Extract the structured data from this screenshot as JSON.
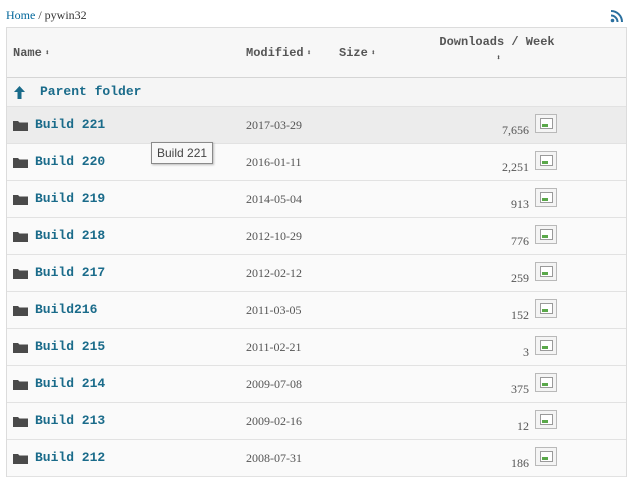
{
  "breadcrumb": {
    "home": "Home",
    "separator": "/",
    "current": "pywin32"
  },
  "columns": {
    "name": "Name",
    "modified": "Modified",
    "size": "Size",
    "downloads": "Downloads / Week",
    "sort_glyph": "⬍"
  },
  "parent_folder": {
    "label": "Parent folder"
  },
  "rows": [
    {
      "name": "Build 221",
      "modified": "2017-03-29",
      "downloads": "7,656"
    },
    {
      "name": "Build 220",
      "modified": "2016-01-11",
      "downloads": "2,251"
    },
    {
      "name": "Build 219",
      "modified": "2014-05-04",
      "downloads": "913"
    },
    {
      "name": "Build 218",
      "modified": "2012-10-29",
      "downloads": "776"
    },
    {
      "name": "Build 217",
      "modified": "2012-02-12",
      "downloads": "259"
    },
    {
      "name": "Build216",
      "modified": "2011-03-05",
      "downloads": "152"
    },
    {
      "name": "Build 215",
      "modified": "2011-02-21",
      "downloads": "3"
    },
    {
      "name": "Build 214",
      "modified": "2009-07-08",
      "downloads": "375"
    },
    {
      "name": "Build 213",
      "modified": "2009-02-16",
      "downloads": "12"
    },
    {
      "name": "Build 212",
      "modified": "2008-07-31",
      "downloads": "186"
    }
  ],
  "tooltip": {
    "text": "Build 221"
  },
  "icons": {
    "rss": "rss-icon",
    "folder": "folder-icon",
    "parent": "arrow-up-icon",
    "chart": "broken-image-icon"
  },
  "colors": {
    "link": "#1a6b8a",
    "rss": "#2a6f9e"
  }
}
